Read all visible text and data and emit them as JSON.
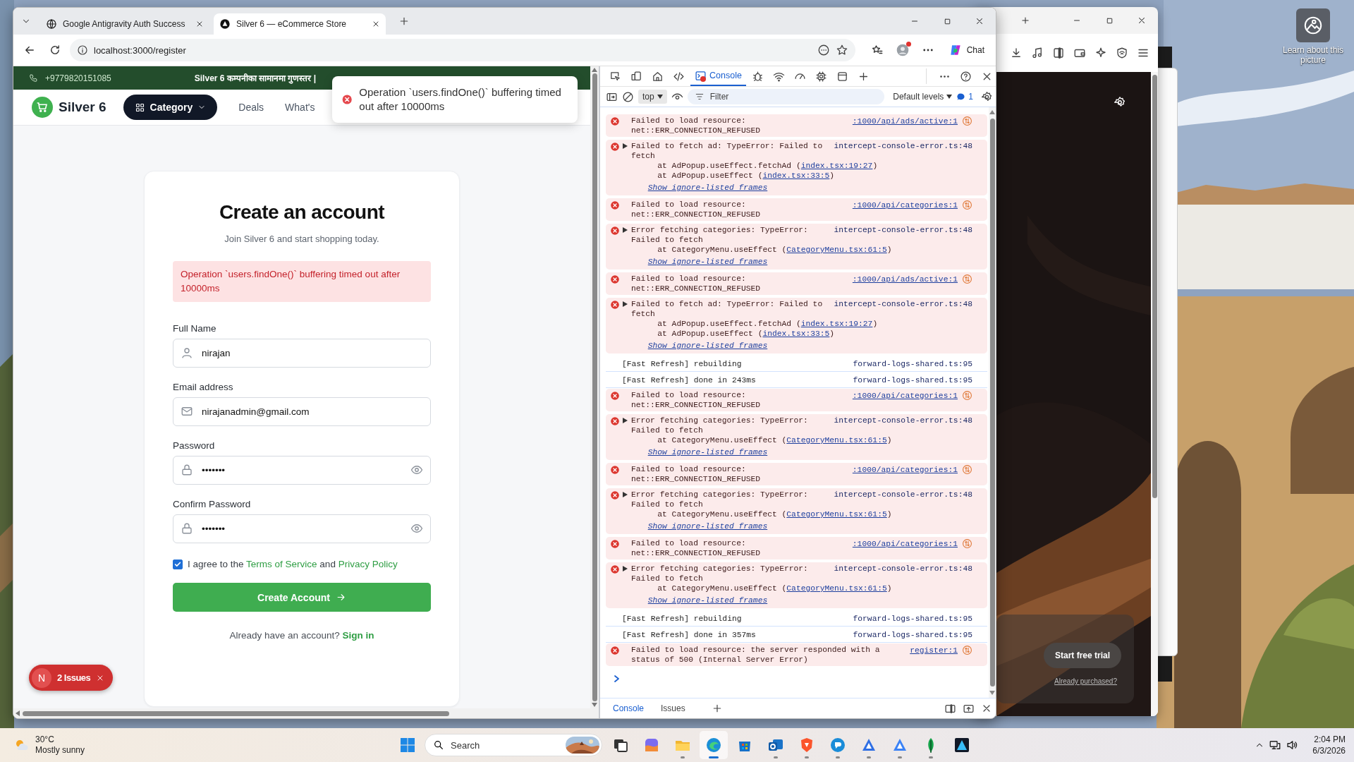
{
  "desktop": {
    "shortcut": {
      "label": "Learn about this picture"
    }
  },
  "browser": {
    "tabs": [
      {
        "title": "Google Antigravity Auth Success",
        "selected": false
      },
      {
        "title": "Silver 6 — eCommerce Store",
        "selected": true
      }
    ],
    "address": "localhost:3000/register",
    "chat_label": "Chat"
  },
  "page": {
    "topbar": {
      "phone": "+9779820151085",
      "promo": "Silver 6 कम्पनीका सामानमा गुणस्तर |"
    },
    "header": {
      "brand": "Silver 6",
      "category": "Category",
      "nav": [
        "Deals",
        "What's"
      ]
    },
    "toast": {
      "message": "Operation `users.findOne()` buffering timed out after 10000ms"
    },
    "form": {
      "title": "Create an account",
      "subtitle": "Join Silver 6 and start shopping today.",
      "error": "Operation `users.findOne()` buffering timed out after 10000ms",
      "fields": [
        {
          "label": "Full Name",
          "value": "nirajan",
          "kind": "name"
        },
        {
          "label": "Email address",
          "value": "nirajanadmin@gmail.com",
          "kind": "email"
        },
        {
          "label": "Password",
          "value": "•••••••",
          "kind": "password"
        },
        {
          "label": "Confirm Password",
          "value": "•••••••",
          "kind": "password"
        }
      ],
      "agree": {
        "checked": true,
        "before": "I agree to the ",
        "terms": "Terms of Service",
        "middle": " and ",
        "privacy": "Privacy Policy"
      },
      "submit": "Create Account",
      "signin_prompt": "Already have an account?",
      "signin_link": "Sign in"
    },
    "issues_badge": {
      "letter": "N",
      "label": "2 Issues"
    }
  },
  "devtools": {
    "panel_tabs": [
      {
        "label": "Console",
        "selected": true
      }
    ],
    "context": "top",
    "filter_placeholder": "Filter",
    "levels": "Default levels",
    "message_count": "1",
    "entries": [
      {
        "kind": "resource",
        "message": "Failed to load resource: net::ERR_CONNECTION_REFUSED",
        "source": ":1000/api/ads/active:1"
      },
      {
        "kind": "error",
        "message": "Failed to fetch ad: TypeError: Failed to fetch",
        "source": "intercept-console-error.ts:48",
        "stack": [
          {
            "text": "at AdPopup.useEffect.fetchAd (",
            "link": "index.tsx:19:27",
            "end": ")"
          },
          {
            "text": "at AdPopup.useEffect (",
            "link": "index.tsx:33:5",
            "end": ")"
          }
        ],
        "show_frames": "Show ignore-listed frames"
      },
      {
        "kind": "resource",
        "message": "Failed to load resource: net::ERR_CONNECTION_REFUSED",
        "source": ":1000/api/categories:1"
      },
      {
        "kind": "error",
        "message": "Error fetching categories: TypeError: Failed to fetch",
        "source": "intercept-console-error.ts:48",
        "stack": [
          {
            "text": "at CategoryMenu.useEffect (",
            "link": "CategoryMenu.tsx:61:5",
            "end": ")"
          }
        ],
        "show_frames": "Show ignore-listed frames"
      },
      {
        "kind": "resource",
        "message": "Failed to load resource: net::ERR_CONNECTION_REFUSED",
        "source": ":1000/api/ads/active:1"
      },
      {
        "kind": "error",
        "message": "Failed to fetch ad: TypeError: Failed to fetch",
        "source": "intercept-console-error.ts:48",
        "stack": [
          {
            "text": "at AdPopup.useEffect.fetchAd (",
            "link": "index.tsx:19:27",
            "end": ")"
          },
          {
            "text": "at AdPopup.useEffect (",
            "link": "index.tsx:33:5",
            "end": ")"
          }
        ],
        "show_frames": "Show ignore-listed frames"
      },
      {
        "kind": "info",
        "message": "[Fast Refresh] rebuilding",
        "source": "forward-logs-shared.ts:95"
      },
      {
        "kind": "info",
        "message": "[Fast Refresh] done in 243ms",
        "source": "forward-logs-shared.ts:95"
      },
      {
        "kind": "resource",
        "message": "Failed to load resource: net::ERR_CONNECTION_REFUSED",
        "source": ":1000/api/categories:1"
      },
      {
        "kind": "error",
        "message": "Error fetching categories: TypeError: Failed to fetch",
        "source": "intercept-console-error.ts:48",
        "stack": [
          {
            "text": "at CategoryMenu.useEffect (",
            "link": "CategoryMenu.tsx:61:5",
            "end": ")"
          }
        ],
        "show_frames": "Show ignore-listed frames"
      },
      {
        "kind": "resource",
        "message": "Failed to load resource: net::ERR_CONNECTION_REFUSED",
        "source": ":1000/api/categories:1"
      },
      {
        "kind": "error",
        "message": "Error fetching categories: TypeError: Failed to fetch",
        "source": "intercept-console-error.ts:48",
        "stack": [
          {
            "text": "at CategoryMenu.useEffect (",
            "link": "CategoryMenu.tsx:61:5",
            "end": ")"
          }
        ],
        "show_frames": "Show ignore-listed frames"
      },
      {
        "kind": "resource",
        "message": "Failed to load resource: net::ERR_CONNECTION_REFUSED",
        "source": ":1000/api/categories:1"
      },
      {
        "kind": "error",
        "message": "Error fetching categories: TypeError: Failed to fetch",
        "source": "intercept-console-error.ts:48",
        "stack": [
          {
            "text": "at CategoryMenu.useEffect (",
            "link": "CategoryMenu.tsx:61:5",
            "end": ")"
          }
        ],
        "show_frames": "Show ignore-listed frames"
      },
      {
        "kind": "info",
        "message": "[Fast Refresh] rebuilding",
        "source": "forward-logs-shared.ts:95"
      },
      {
        "kind": "info",
        "message": "[Fast Refresh] done in 357ms",
        "source": "forward-logs-shared.ts:95"
      },
      {
        "kind": "resource",
        "message": "Failed to load resource: the server responded with a status of 500 (Internal Server Error)",
        "source": "register:1"
      }
    ],
    "drawer_tabs": [
      {
        "label": "Console",
        "selected": true
      },
      {
        "label": "Issues",
        "selected": false
      }
    ]
  },
  "side_window": {
    "trial_button": "Start free trial",
    "purchased_link": "Already purchased?"
  },
  "taskbar": {
    "temperature": "30°C",
    "condition": "Mostly sunny",
    "search_placeholder": "Search",
    "apps": [
      {
        "running": false,
        "selected": false
      },
      {
        "running": false,
        "selected": false
      },
      {
        "running": true,
        "selected": false
      },
      {
        "running": true,
        "selected": true
      },
      {
        "running": false,
        "selected": false
      },
      {
        "running": true,
        "selected": false
      },
      {
        "running": true,
        "selected": false
      },
      {
        "running": true,
        "selected": false
      },
      {
        "running": true,
        "selected": false
      },
      {
        "running": true,
        "selected": false
      },
      {
        "running": true,
        "selected": false
      },
      {
        "running": false,
        "selected": false
      }
    ],
    "time": "2:04 PM",
    "date": "6/3/2026"
  }
}
